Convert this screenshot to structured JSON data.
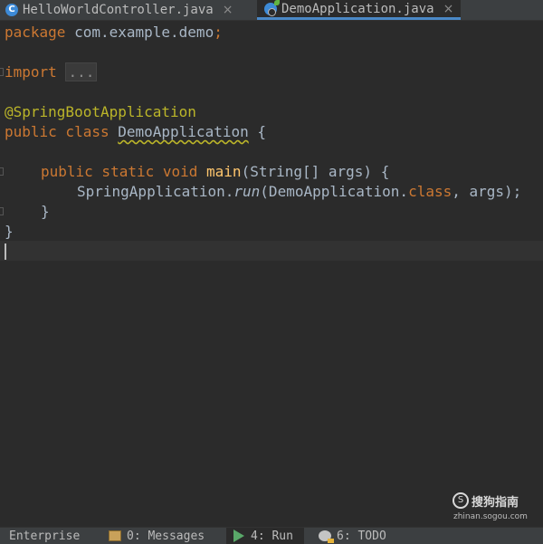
{
  "tabs": [
    {
      "label": "HelloWorldController.java",
      "icon": "java-class-icon",
      "active": false
    },
    {
      "label": "DemoApplication.java",
      "icon": "spring-boot-class-icon",
      "active": true
    }
  ],
  "tab_close_glyph": "×",
  "code": {
    "l1_kw": "package",
    "l1_rest": " com.example.demo",
    "l1_semi": ";",
    "l3_kw": "import",
    "l3_fold": "...",
    "l5_annotation": "@SpringBootApplication",
    "l6_kw": "public class",
    "l6_class": "DemoApplication",
    "l6_rest": " {",
    "l8_kw": "public static void",
    "l8_method": "main",
    "l8_rest": "(String[] args) {",
    "l9_class": "SpringApplication.",
    "l9_call": "run",
    "l9_args_a": "(DemoApplication.",
    "l9_kw": "class",
    "l9_args_b": ", args);",
    "l10": "}",
    "l11": "}"
  },
  "watermark": {
    "logo_glyph": "S",
    "title": "搜狗指南",
    "subtitle": "zhinan.sogou.com"
  },
  "bottom_tabs": [
    {
      "label": "Enterprise"
    },
    {
      "label": "0: Messages"
    },
    {
      "label": "4: Run"
    },
    {
      "label": "6: TODO"
    }
  ]
}
